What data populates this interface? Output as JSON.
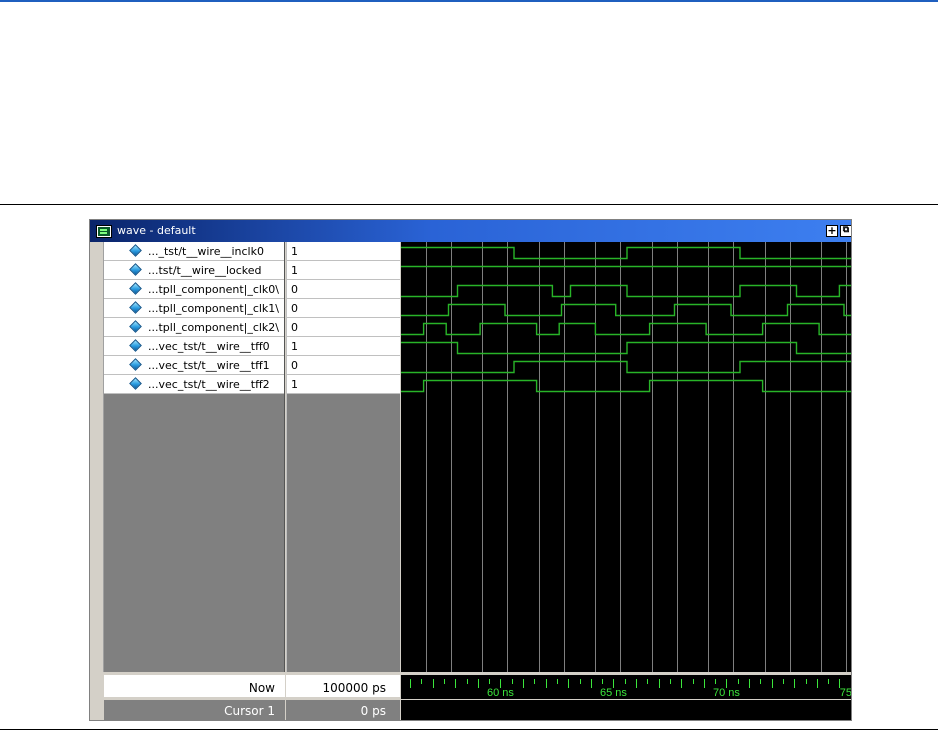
{
  "window": {
    "title": "wave - default",
    "buttons": {
      "add": "+",
      "undock": "⧉"
    }
  },
  "signals": [
    {
      "name": "..._tst/t__wire__inclk0",
      "value": "1"
    },
    {
      "name": "...tst/t__wire__locked",
      "value": "1"
    },
    {
      "name": "...tpll_component|_clk0\\",
      "value": "0"
    },
    {
      "name": "...tpll_component|_clk1\\",
      "value": "0"
    },
    {
      "name": "...tpll_component|_clk2\\",
      "value": "0"
    },
    {
      "name": "...vec_tst/t__wire__tff0",
      "value": "1"
    },
    {
      "name": "...vec_tst/t__wire__tff1",
      "value": "0"
    },
    {
      "name": "...vec_tst/t__wire__tff2",
      "value": "1"
    }
  ],
  "footer": {
    "now_label": "Now",
    "now_value": "100000 ps",
    "cursor_label": "Cursor 1",
    "cursor_value": "0 ps"
  },
  "timeline": {
    "labels": [
      "60 ns",
      "65 ns",
      "70 ns",
      "75"
    ]
  },
  "colors": {
    "wave": "#28b428",
    "grid": "#7f7f7f",
    "timeline_text": "#3ce63c",
    "title_bar_start": "#0a246a",
    "title_bar_end": "#3d7ff0"
  },
  "waveforms": {
    "time_start_ns": 55.6,
    "time_end_ns": 75.6,
    "gridlines_ns": [
      56.7,
      59.2,
      61.7,
      64.2,
      66.7,
      69.2,
      71.7,
      74.2,
      57.8,
      60.3,
      62.8,
      65.3,
      67.8,
      70.3,
      72.8,
      75.3
    ],
    "edges_ns": [
      [
        [
          55.6,
          1
        ],
        [
          60.6,
          0
        ],
        [
          65.6,
          1
        ],
        [
          70.6,
          0
        ]
      ],
      [
        [
          55.6,
          1
        ]
      ],
      [
        [
          55.6,
          0
        ],
        [
          58.1,
          1
        ],
        [
          62.3,
          0
        ],
        [
          63.1,
          1
        ],
        [
          65.6,
          0
        ],
        [
          69.8,
          0
        ],
        [
          70.6,
          1
        ],
        [
          73.1,
          0
        ],
        [
          75.0,
          1
        ]
      ],
      [
        [
          55.6,
          0
        ],
        [
          57.7,
          1
        ],
        [
          60.2,
          0
        ],
        [
          62.7,
          1
        ],
        [
          65.1,
          0
        ],
        [
          67.7,
          1
        ],
        [
          70.2,
          0
        ],
        [
          72.7,
          1
        ],
        [
          75.2,
          0
        ]
      ],
      [
        [
          55.6,
          0
        ],
        [
          56.6,
          1
        ],
        [
          57.6,
          0
        ],
        [
          59.1,
          1
        ],
        [
          61.6,
          0
        ],
        [
          62.6,
          1
        ],
        [
          64.2,
          0
        ],
        [
          66.6,
          1
        ],
        [
          69.1,
          0
        ],
        [
          71.6,
          1
        ],
        [
          74.1,
          0
        ]
      ],
      [
        [
          55.6,
          1
        ],
        [
          58.1,
          0
        ],
        [
          65.6,
          1
        ],
        [
          73.1,
          0
        ]
      ],
      [
        [
          55.6,
          0
        ],
        [
          60.6,
          1
        ],
        [
          65.6,
          0
        ],
        [
          70.6,
          1
        ]
      ],
      [
        [
          55.6,
          0
        ],
        [
          56.6,
          1
        ],
        [
          61.6,
          0
        ],
        [
          66.6,
          1
        ],
        [
          71.6,
          0
        ]
      ]
    ]
  }
}
